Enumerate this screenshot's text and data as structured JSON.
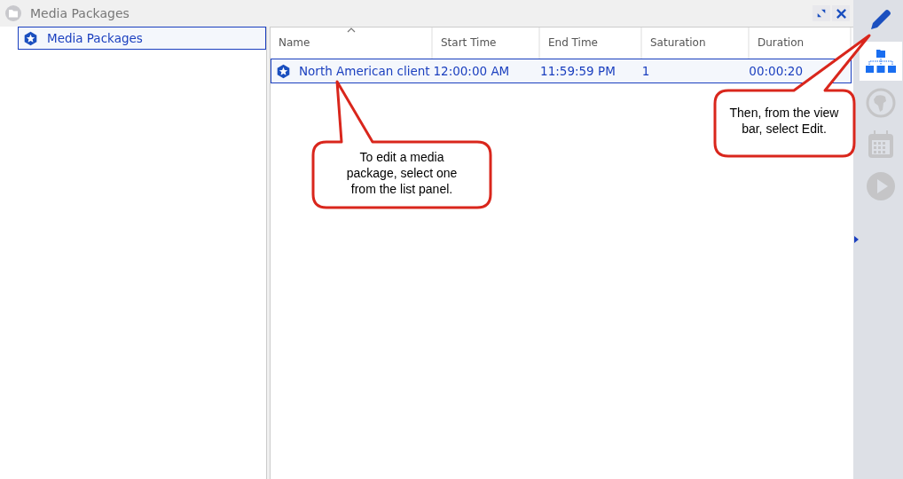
{
  "window": {
    "title": "Media Packages"
  },
  "tree": {
    "items": [
      {
        "label": "Media Packages",
        "selected": true
      }
    ]
  },
  "table": {
    "columns": [
      {
        "label": "Name",
        "sorted": true
      },
      {
        "label": "Start Time",
        "sorted": false
      },
      {
        "label": "End Time",
        "sorted": false
      },
      {
        "label": "Saturation",
        "sorted": false
      },
      {
        "label": "Duration",
        "sorted": false
      }
    ],
    "rows": [
      {
        "cells": [
          "North American client",
          "12:00:00 AM",
          "11:59:59 PM",
          "1",
          "00:00:20"
        ],
        "selected": true
      }
    ]
  },
  "view_bar": {
    "items": [
      {
        "kind": "edit",
        "selected": false,
        "disabled": false
      },
      {
        "kind": "tree",
        "selected": true,
        "disabled": false
      },
      {
        "kind": "globe",
        "selected": false,
        "disabled": true
      },
      {
        "kind": "calendar",
        "selected": false,
        "disabled": true
      },
      {
        "kind": "play",
        "selected": false,
        "disabled": true
      }
    ]
  },
  "callouts": [
    {
      "text": "To edit a media package, select one from the list panel."
    },
    {
      "text": "Then, from the view bar, select Edit."
    }
  ]
}
